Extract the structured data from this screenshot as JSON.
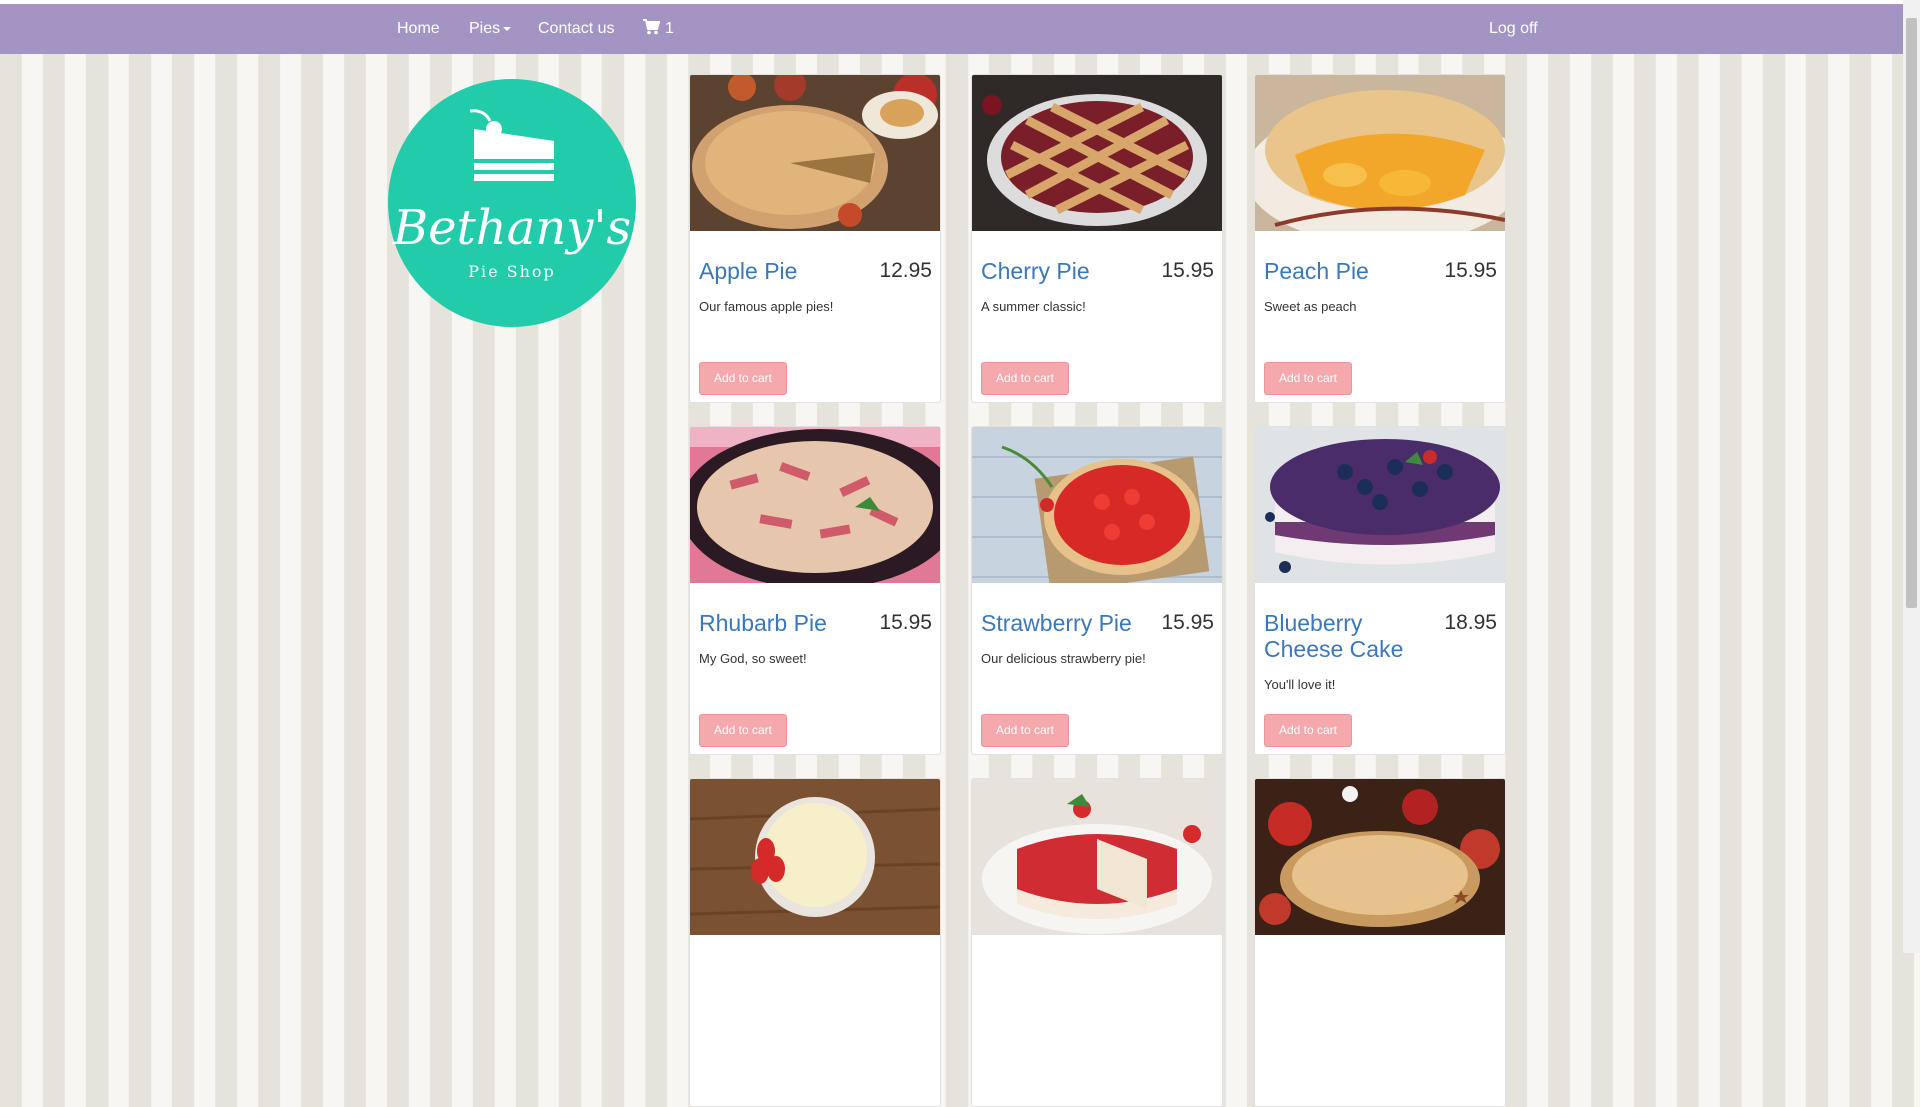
{
  "nav": {
    "home": "Home",
    "pies": "Pies",
    "contact": "Contact us",
    "cart_count": "1",
    "logoff": "Log off"
  },
  "logo": {
    "brand_name": "Bethany's",
    "tagline": "Pie Shop",
    "color": "#22ccaa"
  },
  "products": [
    {
      "name": "Apple Pie",
      "price": "12.95",
      "description": "Our famous apple pies!",
      "button": "Add to cart"
    },
    {
      "name": "Cherry Pie",
      "price": "15.95",
      "description": "A summer classic!",
      "button": "Add to cart"
    },
    {
      "name": "Peach Pie",
      "price": "15.95",
      "description": "Sweet as peach",
      "button": "Add to cart"
    },
    {
      "name": "Rhubarb Pie",
      "price": "15.95",
      "description": "My God, so sweet!",
      "button": "Add to cart"
    },
    {
      "name": "Strawberry Pie",
      "price": "15.95",
      "description": "Our delicious strawberry pie!",
      "button": "Add to cart"
    },
    {
      "name": "Blueberry Cheese Cake",
      "price": "18.95",
      "description": "You'll love it!",
      "button": "Add to cart"
    }
  ],
  "colors": {
    "navbar": "#a494c4",
    "link": "#3a78b8",
    "button": "#f5a9ad"
  }
}
